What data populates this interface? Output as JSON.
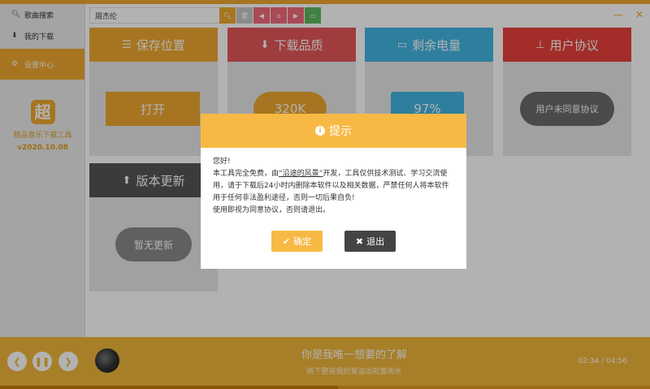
{
  "sidebar": {
    "items": [
      {
        "label": "歌曲搜索",
        "icon": "search-icon"
      },
      {
        "label": "我的下载",
        "icon": "download-icon"
      },
      {
        "label": "设置中心",
        "icon": "gear-icon"
      }
    ],
    "logo_char": "超",
    "app_name": "精品音乐下载工具",
    "version": "v2020.10.08"
  },
  "search": {
    "value": "周杰伦"
  },
  "toolbar": {
    "colors": [
      "#f0a830",
      "#c8c8c8",
      "#f36a7a",
      "#f36a7a",
      "#f36a7a",
      "#5cb85c"
    ]
  },
  "cards": {
    "save": {
      "title": "保存位置",
      "action": "打开",
      "color": "#f0a830"
    },
    "quality": {
      "title": "下载品质",
      "action": "320K",
      "color": "#e4585a"
    },
    "battery": {
      "title": "剩余电量",
      "action": "97%",
      "color": "#43b5e3"
    },
    "agreement": {
      "title": "用户协议",
      "action": "用户未同意协议",
      "color": "#e8413b"
    },
    "update": {
      "title": "版本更新",
      "action": "暂无更新",
      "color": "#555555"
    }
  },
  "modal": {
    "title": "提示",
    "greeting": "您好!",
    "line1_a": "本工具完全免费，由",
    "line1_highlight": "“沿途的风景”",
    "line1_b": "开发，工具仅供技术测试、学习交流使用，请于下载后24小时内删除本软件以及相关数据，严禁任何人将本软件用于任何非法盈利途径，否则一切后果自负!",
    "line2": "使用即视为同意协议，否则请退出。",
    "confirm": "确定",
    "exit": "退出"
  },
  "player": {
    "title": "你是我唯一想要的了解",
    "subtitle": "雨下整夜我的爱溢出就像雨水",
    "time": "02:34 / 04:56",
    "progress": 0.52
  }
}
